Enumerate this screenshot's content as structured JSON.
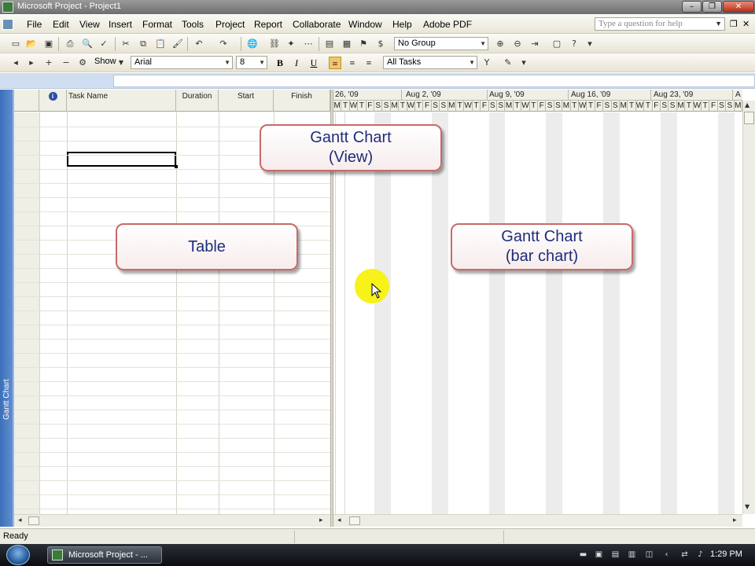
{
  "window": {
    "title": "Microsoft Project - Project1",
    "minimize": "–",
    "restore": "❐",
    "close": "✕"
  },
  "menu": {
    "items": [
      "File",
      "Edit",
      "View",
      "Insert",
      "Format",
      "Tools",
      "Project",
      "Report",
      "Collaborate",
      "Window",
      "Help",
      "Adobe PDF"
    ],
    "help_placeholder": "Type a question for help"
  },
  "toolbar": {
    "group_combo": "No Group",
    "show_label": "Show",
    "font_combo": "Arial",
    "size_combo": "8",
    "bold": "B",
    "italic": "I",
    "underline": "U",
    "filter_combo": "All Tasks"
  },
  "viewbar": {
    "label": "Gantt Chart"
  },
  "table": {
    "columns": [
      "i",
      "Task Name",
      "Duration",
      "Start",
      "Finish"
    ]
  },
  "gantt": {
    "weeks": [
      "26, '09",
      "Aug 2, '09",
      "Aug 9, '09",
      "Aug 16, '09",
      "Aug 23, '09",
      "A"
    ],
    "day_letters": [
      "M",
      "T",
      "W",
      "T",
      "F",
      "S",
      "S"
    ]
  },
  "callouts": {
    "view": [
      "Gantt Chart",
      "(View)"
    ],
    "table": [
      "Table"
    ],
    "bar_chart": [
      "Gantt Chart",
      "(bar chart)"
    ]
  },
  "status": {
    "text": "Ready"
  },
  "taskbar": {
    "app_button": "Microsoft Project - ...",
    "clock": "1:29 PM"
  }
}
